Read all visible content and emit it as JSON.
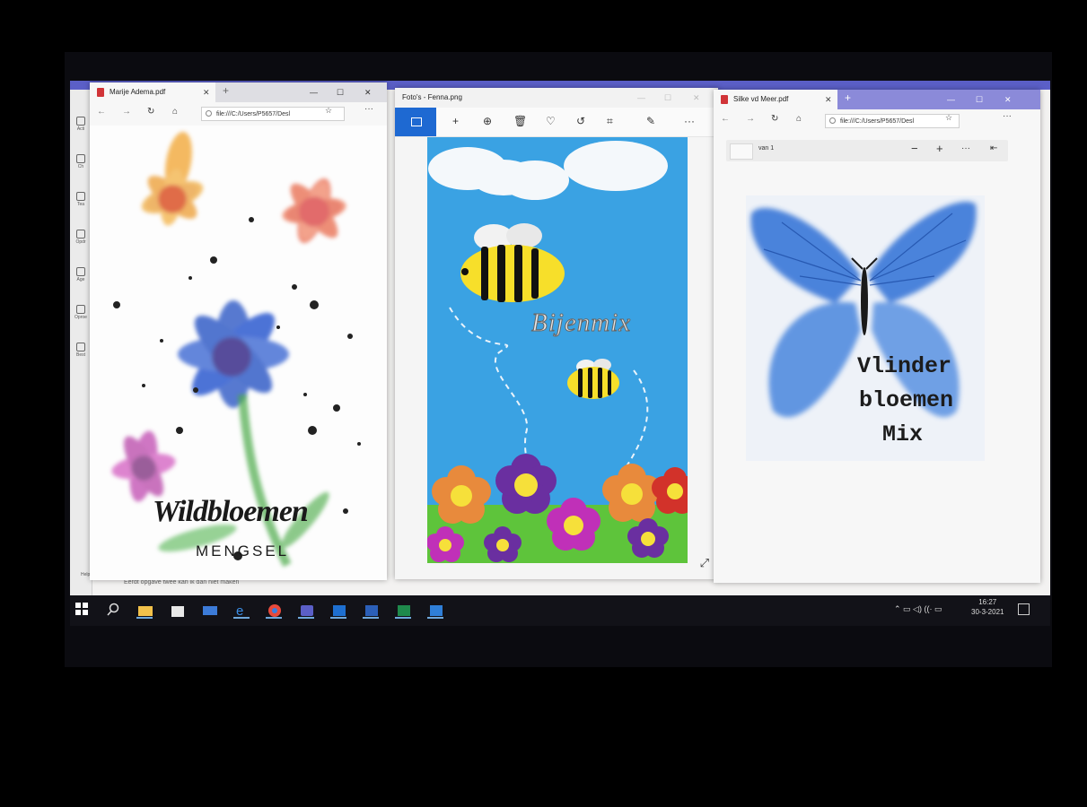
{
  "bg_app": {
    "rail_items": [
      "Acti",
      "Ch",
      "Tea",
      "Opdr",
      "Age",
      "Oproe",
      "Best"
    ],
    "help_label": "Help",
    "footer_text": "Eerdt opgave twee kan ik dan niet maken"
  },
  "window1": {
    "tab_title": "Marije Adema.pdf",
    "url": "file:///C:/Users/P5657/Desl",
    "doc_title": "Wildbloemen",
    "doc_subtitle": "MENGSEL"
  },
  "window2": {
    "title": "Foto's - Fenna.png",
    "image_text": "Bijenmix"
  },
  "window3": {
    "tab_title": "Silke vd Meer.pdf",
    "url": "file:///C:/Users/P5657/Desl",
    "page_count": "van 1",
    "doc_lines": [
      "Vlinder",
      "bloemen",
      "Mix"
    ]
  },
  "taskbar": {
    "time": "16:27",
    "date": "30-3-2021"
  },
  "colors": {
    "teams_purple": "#5b5fc7",
    "photos_blue": "#1e69d2",
    "pdf_red": "#d13438"
  }
}
